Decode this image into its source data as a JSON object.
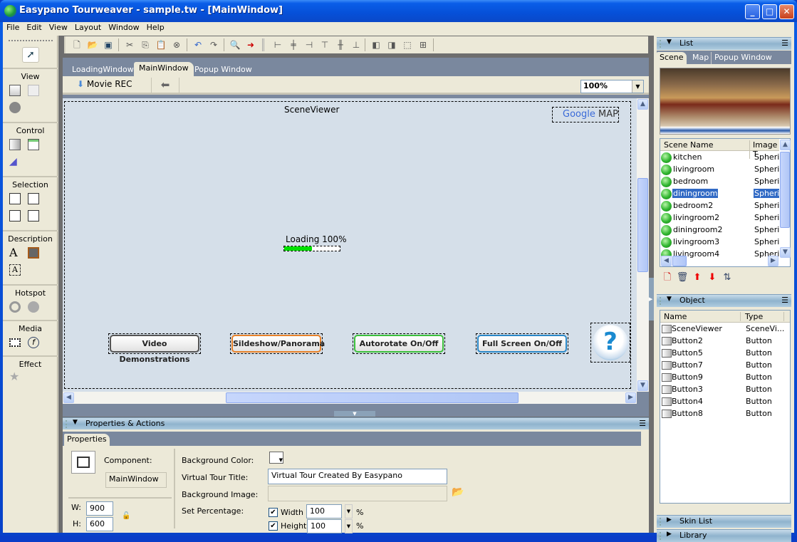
{
  "window": {
    "title": "Easypano Tourweaver - sample.tw - [MainWindow]",
    "controls": {
      "minimize": "_",
      "maximize": "□",
      "close": "✕"
    }
  },
  "menu": [
    "File",
    "Edit",
    "View",
    "Layout",
    "Window",
    "Help"
  ],
  "toolbar": {
    "icons": [
      "new-file-icon",
      "open-folder-icon",
      "save-icon",
      "cut-icon",
      "copy-icon",
      "paste-icon",
      "delete-icon",
      "undo-icon",
      "redo-icon",
      "preview-icon",
      "publish-icon",
      "align-left-icon",
      "align-center-icon",
      "align-right-icon",
      "align-top-icon",
      "align-middle-icon",
      "align-bottom-icon",
      "bring-front-icon",
      "send-back-icon",
      "group-icon",
      "ungroup-icon"
    ]
  },
  "toolbox": {
    "sections": [
      {
        "label": "View"
      },
      {
        "label": "Control"
      },
      {
        "label": "Selection"
      },
      {
        "label": "Description"
      },
      {
        "label": "Hotspot"
      },
      {
        "label": "Media"
      },
      {
        "label": "Effect"
      }
    ]
  },
  "document": {
    "tabs": [
      "LoadingWindow",
      "MainWindow",
      "Popup Window"
    ],
    "active_tab": "MainWindow",
    "movie_rec_label": "Movie REC",
    "zoom_value": "100%",
    "canvas": {
      "scene_viewer_label": "SceneViewer",
      "google_map": {
        "google": "Google",
        "map": "MAP"
      },
      "loading_label": "Loading 100%",
      "loading_progress": 0.5,
      "buttons": [
        {
          "label": "Video Demonstrations",
          "color": "#555555"
        },
        {
          "label": "Sildeshow/Panorama",
          "color": "#e8822a"
        },
        {
          "label": "Autorotate On/Off",
          "color": "#3cc03c"
        },
        {
          "label": "Full Screen On/Off",
          "color": "#2a88c8"
        }
      ],
      "help_glyph": "?"
    }
  },
  "properties_panel": {
    "title": "Properties & Actions",
    "tab": "Properties",
    "component_label": "Component:",
    "component_value": "MainWindow",
    "w_label": "W:",
    "w_value": "900",
    "h_label": "H:",
    "h_value": "600",
    "bg_color_label": "Background Color:",
    "tour_title_label": "Virtual Tour Title:",
    "tour_title_value": "Virtual Tour Created By Easypano",
    "bg_image_label": "Background Image:",
    "bg_image_value": "",
    "set_pct_label": "Set Percentage:",
    "width_label": "Width",
    "width_value": "100",
    "width_checked": true,
    "height_label": "Height",
    "height_value": "100",
    "height_checked": true,
    "pct_symbol": "%"
  },
  "list_panel": {
    "title": "List",
    "tabs": [
      "Scene",
      "Map",
      "Popup Window"
    ],
    "active_tab": "Scene",
    "columns": [
      "Scene Name",
      "Image T"
    ],
    "scenes": [
      {
        "name": "kitchen",
        "type": "Spheric"
      },
      {
        "name": "livingroom",
        "type": "Spheric"
      },
      {
        "name": "bedroom",
        "type": "Spheric"
      },
      {
        "name": "diningroom",
        "type": "Spheric",
        "selected": true
      },
      {
        "name": "bedroom2",
        "type": "Spheric"
      },
      {
        "name": "livingroom2",
        "type": "Spheric"
      },
      {
        "name": "diningroom2",
        "type": "Spheric"
      },
      {
        "name": "livingroom3",
        "type": "Spheric"
      },
      {
        "name": "livingroom4",
        "type": "Spheric"
      }
    ]
  },
  "object_panel": {
    "title": "Object",
    "columns": [
      "Name",
      "Type"
    ],
    "objects": [
      {
        "name": "SceneViewer",
        "type": "SceneVi..."
      },
      {
        "name": "Button2",
        "type": "Button"
      },
      {
        "name": "Button5",
        "type": "Button"
      },
      {
        "name": "Button7",
        "type": "Button"
      },
      {
        "name": "Button9",
        "type": "Button"
      },
      {
        "name": "Button3",
        "type": "Button"
      },
      {
        "name": "Button4",
        "type": "Button"
      },
      {
        "name": "Button8",
        "type": "Button"
      }
    ]
  },
  "collapsed_panels": [
    "Skin List",
    "Library"
  ]
}
